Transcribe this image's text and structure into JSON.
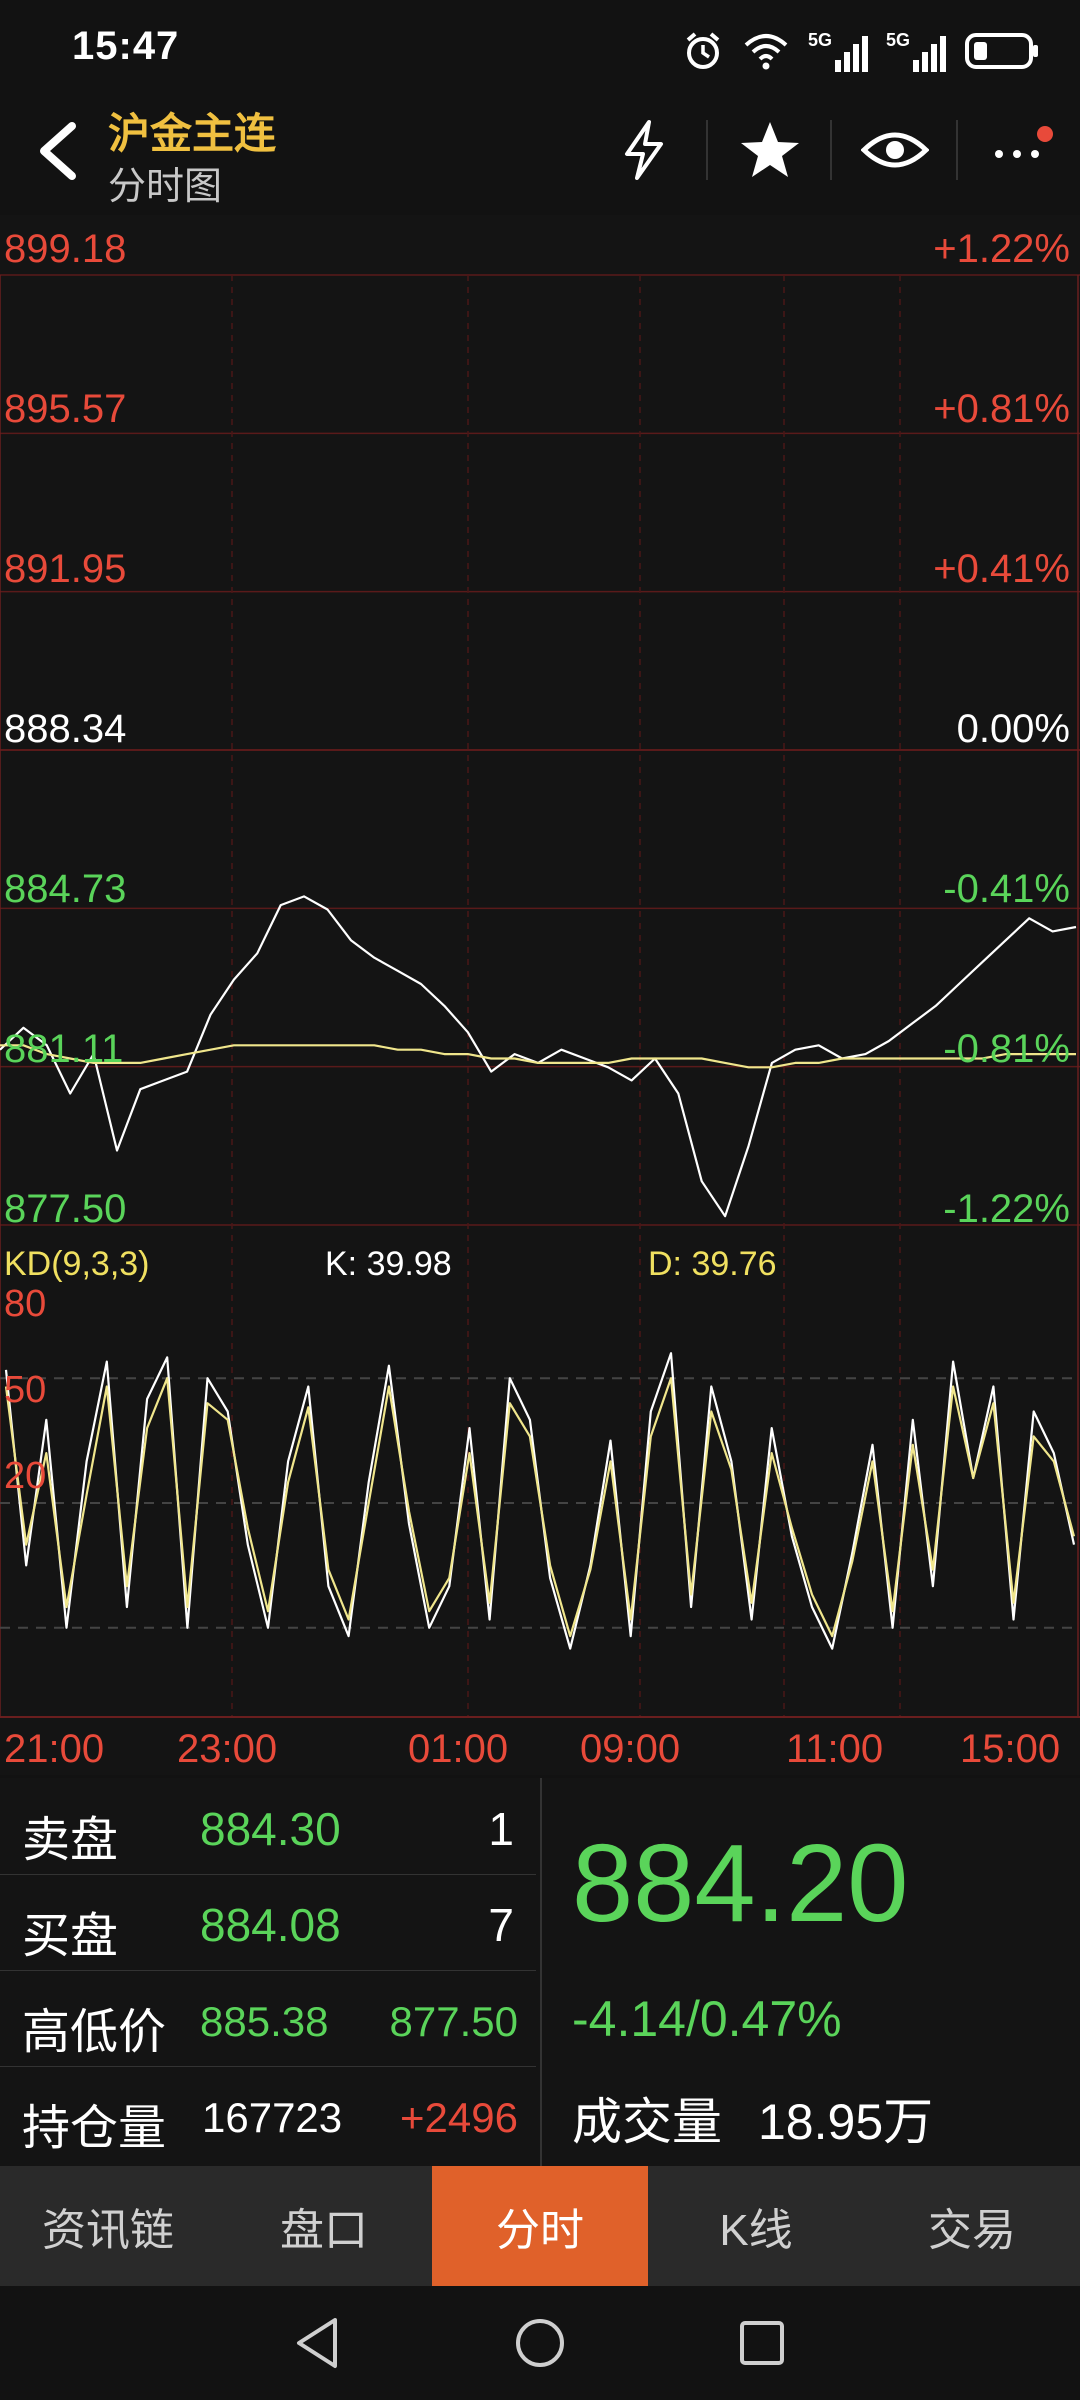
{
  "status_bar": {
    "time": "15:47",
    "icons": [
      "alarm-icon",
      "wifi-icon",
      "signal-5g-1-icon",
      "signal-5g-2-icon",
      "battery-icon"
    ],
    "network_label": "5G"
  },
  "header": {
    "title": "沪金主连",
    "subtitle": "分时图",
    "actions": [
      "lightning-icon",
      "star-icon",
      "eye-icon",
      "more-icon"
    ]
  },
  "chart": {
    "price_labels": [
      "899.18",
      "895.57",
      "891.95",
      "888.34",
      "884.73",
      "881.11",
      "877.50"
    ],
    "pct_labels": [
      "+1.22%",
      "+0.81%",
      "+0.41%",
      "0.00%",
      "-0.41%",
      "-0.81%",
      "-1.22%"
    ],
    "kd": {
      "name": "KD(9,3,3)",
      "k_label": "K: 39.98",
      "d_label": "D: 39.76",
      "levels": [
        "80",
        "50",
        "20"
      ]
    },
    "time_labels": [
      "21:00",
      "23:00",
      "01:00",
      "09:00",
      "11:00",
      "15:00"
    ],
    "colors": {
      "up": "#e84a3a",
      "down": "#5ad45a",
      "price_line": "#ffffff",
      "avg_line": "#f0e68c",
      "grid": "#5a1a1a"
    }
  },
  "chart_data": [
    {
      "type": "line",
      "title": "",
      "x_ticks": [
        "21:00",
        "23:00",
        "01:00",
        "09:00",
        "11:00",
        "15:00"
      ],
      "ylim": [
        877.5,
        899.18
      ],
      "y_ticks": [
        899.18,
        895.57,
        891.95,
        888.34,
        884.73,
        881.11,
        877.5
      ],
      "series": [
        {
          "values": [
            881.5,
            882.0,
            881.6,
            880.5,
            881.4,
            879.2,
            880.6,
            880.8,
            881.0,
            882.3,
            883.1,
            883.7,
            884.8,
            885.0,
            884.7,
            884.0,
            883.6,
            883.3,
            883.0,
            882.5,
            881.9,
            881.0,
            881.4,
            881.2,
            881.5,
            881.3,
            881.1,
            880.8,
            881.3,
            880.5,
            878.5,
            877.7,
            879.3,
            881.2,
            881.5,
            881.6,
            881.3,
            881.4,
            881.7,
            882.1,
            882.5,
            883.0,
            883.5,
            884.0,
            884.5,
            884.2,
            884.3
          ]
        },
        {
          "values": [
            881.6,
            881.6,
            881.4,
            881.3,
            881.2,
            881.2,
            881.2,
            881.3,
            881.4,
            881.5,
            881.6,
            881.6,
            881.6,
            881.6,
            881.6,
            881.6,
            881.6,
            881.5,
            881.5,
            881.4,
            881.4,
            881.3,
            881.3,
            881.2,
            881.2,
            881.2,
            881.2,
            881.3,
            881.3,
            881.3,
            881.3,
            881.2,
            881.1,
            881.1,
            881.2,
            881.2,
            881.3,
            881.3,
            881.3,
            881.3,
            881.3,
            881.3,
            881.3,
            881.4,
            881.4,
            881.4,
            881.4
          ]
        }
      ]
    },
    {
      "type": "line",
      "title": "",
      "ylim": [
        0,
        100
      ],
      "y_ticks": [
        80,
        50,
        20
      ],
      "series": [
        {
          "name": "K",
          "values": [
            82,
            35,
            70,
            20,
            60,
            84,
            25,
            75,
            85,
            20,
            80,
            72,
            40,
            20,
            60,
            78,
            30,
            18,
            55,
            83,
            45,
            20,
            30,
            68,
            22,
            80,
            70,
            32,
            15,
            35,
            65,
            18,
            72,
            86,
            25,
            78,
            60,
            22,
            68,
            42,
            25,
            15,
            38,
            64,
            20,
            70,
            30,
            84,
            56,
            78,
            22,
            72,
            62,
            40
          ]
        },
        {
          "name": "D",
          "values": [
            78,
            40,
            62,
            25,
            52,
            78,
            30,
            68,
            80,
            25,
            74,
            70,
            44,
            24,
            55,
            73,
            34,
            22,
            50,
            78,
            48,
            24,
            32,
            62,
            26,
            74,
            66,
            35,
            18,
            34,
            60,
            22,
            66,
            80,
            28,
            72,
            58,
            26,
            62,
            44,
            28,
            18,
            36,
            60,
            24,
            64,
            34,
            78,
            56,
            74,
            26,
            66,
            60,
            42
          ]
        }
      ]
    }
  ],
  "info": {
    "sell_label": "卖盘",
    "sell_price": "884.30",
    "sell_qty": "1",
    "buy_label": "买盘",
    "buy_price": "884.08",
    "buy_qty": "7",
    "highlow_label": "高低价",
    "high": "885.38",
    "low": "877.50",
    "oi_label": "持仓量",
    "oi_value": "167723",
    "oi_change": "+2496",
    "last_price": "884.20",
    "change": "-4.14/0.47%",
    "volume_label": "成交量",
    "volume_value": "18.95万"
  },
  "tabs": [
    {
      "label": "资讯链",
      "active": false
    },
    {
      "label": "盘口",
      "active": false
    },
    {
      "label": "分时",
      "active": true
    },
    {
      "label": "K线",
      "active": false
    },
    {
      "label": "交易",
      "active": false
    }
  ],
  "nav_bar": [
    "back-triangle-icon",
    "home-circle-icon",
    "recents-square-icon"
  ]
}
